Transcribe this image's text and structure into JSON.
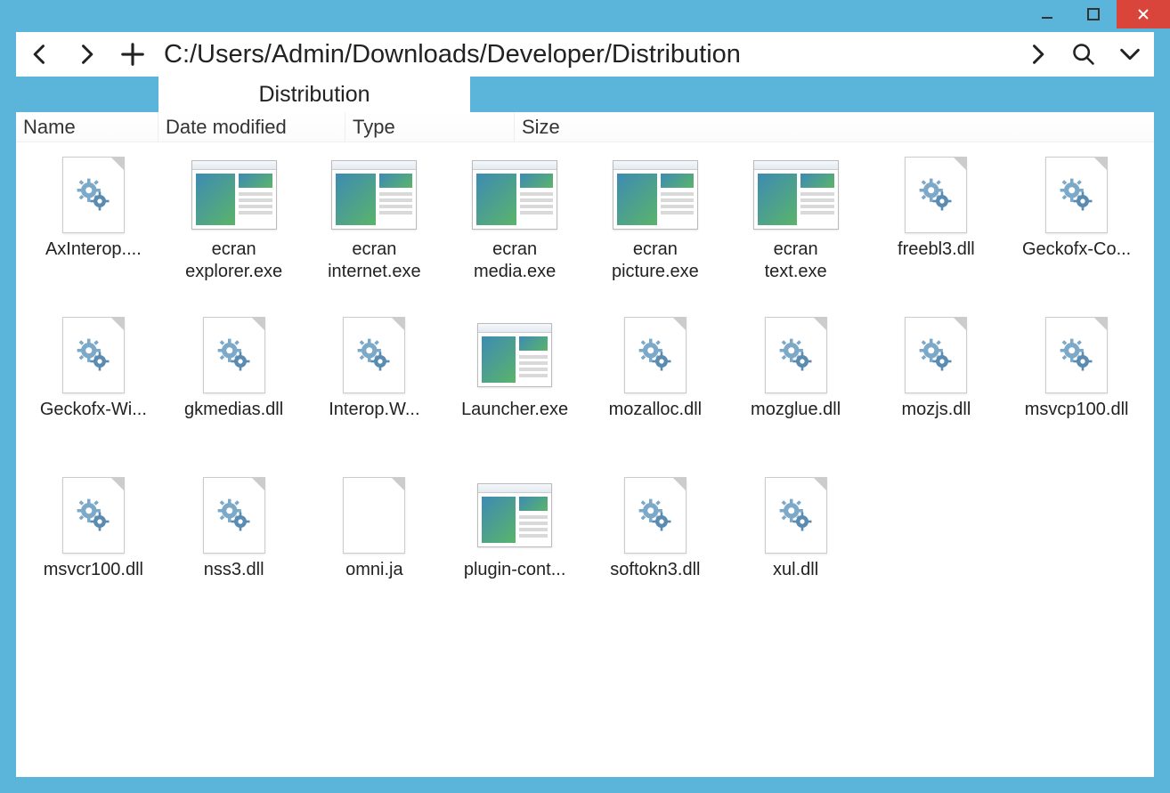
{
  "titlebar": {},
  "toolbar": {
    "path": "C:/Users/Admin/Downloads/Developer/Distribution"
  },
  "tabs": {
    "active_label": "Distribution"
  },
  "columns": {
    "name": "Name",
    "date": "Date modified",
    "type": "Type",
    "size": "Size"
  },
  "files": [
    {
      "label": "AxInterop....",
      "icon": "dll"
    },
    {
      "label": "ecran\nexplorer.exe",
      "icon": "exe"
    },
    {
      "label": "ecran\ninternet.exe",
      "icon": "exe"
    },
    {
      "label": "ecran\nmedia.exe",
      "icon": "exe"
    },
    {
      "label": "ecran\npicture.exe",
      "icon": "exe"
    },
    {
      "label": "ecran\ntext.exe",
      "icon": "exe"
    },
    {
      "label": "freebl3.dll",
      "icon": "dll"
    },
    {
      "label": "Geckofx-Co...",
      "icon": "dll"
    },
    {
      "label": "Geckofx-Wi...",
      "icon": "dll"
    },
    {
      "label": "gkmedias.dll",
      "icon": "dll"
    },
    {
      "label": "Interop.W...",
      "icon": "dll"
    },
    {
      "label": "Launcher.exe",
      "icon": "exe-small"
    },
    {
      "label": "mozalloc.dll",
      "icon": "dll"
    },
    {
      "label": "mozglue.dll",
      "icon": "dll"
    },
    {
      "label": "mozjs.dll",
      "icon": "dll"
    },
    {
      "label": "msvcp100.dll",
      "icon": "dll"
    },
    {
      "label": "msvcr100.dll",
      "icon": "dll"
    },
    {
      "label": "nss3.dll",
      "icon": "dll"
    },
    {
      "label": "omni.ja",
      "icon": "blank"
    },
    {
      "label": "plugin-cont...",
      "icon": "exe-small"
    },
    {
      "label": "softokn3.dll",
      "icon": "dll"
    },
    {
      "label": "xul.dll",
      "icon": "dll"
    }
  ]
}
